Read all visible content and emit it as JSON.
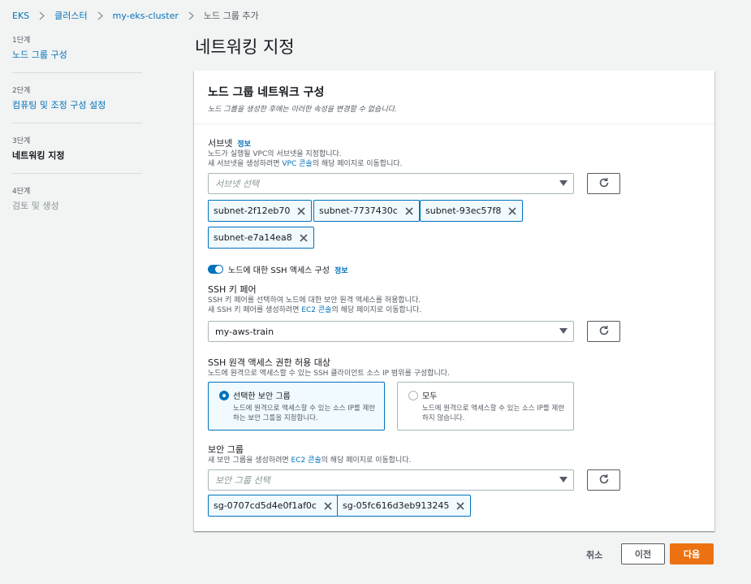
{
  "breadcrumb": {
    "items": [
      "EKS",
      "클러스터",
      "my-eks-cluster"
    ],
    "current": "노드 그룹 추가"
  },
  "steps": [
    {
      "num": "1단계",
      "label": "노드 그룹 구성"
    },
    {
      "num": "2단계",
      "label": "컴퓨팅 및 조정 구성 설정"
    },
    {
      "num": "3단계",
      "label": "네트워킹 지정"
    },
    {
      "num": "4단계",
      "label": "검토 및 생성"
    }
  ],
  "page_title": "네트워킹 지정",
  "panel": {
    "title": "노드 그룹 네트워크 구성",
    "desc": "노드 그룹을 생성한 후에는 이러한 속성을 변경할 수 없습니다."
  },
  "subnet": {
    "label": "서브넷",
    "info": "정보",
    "desc1": "노드가 실행될 VPC의 서브넷을 지정합니다.",
    "desc2_pre": "새 서브넷을 생성하려면 ",
    "desc2_link": "VPC 콘솔",
    "desc2_post": "의 해당 페이지로 이동합니다.",
    "placeholder": "서브넷 선택",
    "tokens": [
      "subnet-2f12eb70",
      "subnet-7737430c",
      "subnet-93ec57f8",
      "subnet-e7a14ea8"
    ]
  },
  "ssh_toggle": {
    "label": "노드에 대한 SSH 액세스 구성",
    "info": "정보",
    "enabled": true
  },
  "ssh_key": {
    "label": "SSH 키 페어",
    "desc1": "SSH 키 페어를 선택하여 노드에 대한 보안 원격 액세스를 허용합니다.",
    "desc2_pre": "새 SSH 키 페어를 생성하려면 ",
    "desc2_link": "EC2 콘솔",
    "desc2_post": "의 해당 페이지로 이동합니다.",
    "value": "my-aws-train"
  },
  "ssh_access": {
    "label": "SSH 원격 액세스 권한 허용 대상",
    "desc": "노드에 원격으로 액세스할 수 있는 SSH 클라이언트 소스 IP 범위를 구성합니다.",
    "options": [
      {
        "title": "선택한 보안 그룹",
        "desc": "노드에 원격으로 액세스할 수 있는 소스 IP를 제한하는 보안 그룹을 지정합니다.",
        "selected": true
      },
      {
        "title": "모두",
        "desc": "노드에 원격으로 액세스할 수 있는 소스 IP를 제한하지 않습니다.",
        "selected": false
      }
    ]
  },
  "security_group": {
    "label": "보안 그룹",
    "desc_pre": "새 보안 그룹을 생성하려면 ",
    "desc_link": "EC2 콘솔",
    "desc_post": "의 해당 페이지로 이동합니다.",
    "placeholder": "보안 그룹 선택",
    "tokens": [
      "sg-0707cd5d4e0f1af0c",
      "sg-05fc616d3eb913245"
    ]
  },
  "footer": {
    "cancel": "취소",
    "prev": "이전",
    "next": "다음"
  },
  "colors": {
    "link": "#0073bb",
    "primary_button": "#ec7211",
    "token_bg": "#f1faff"
  }
}
